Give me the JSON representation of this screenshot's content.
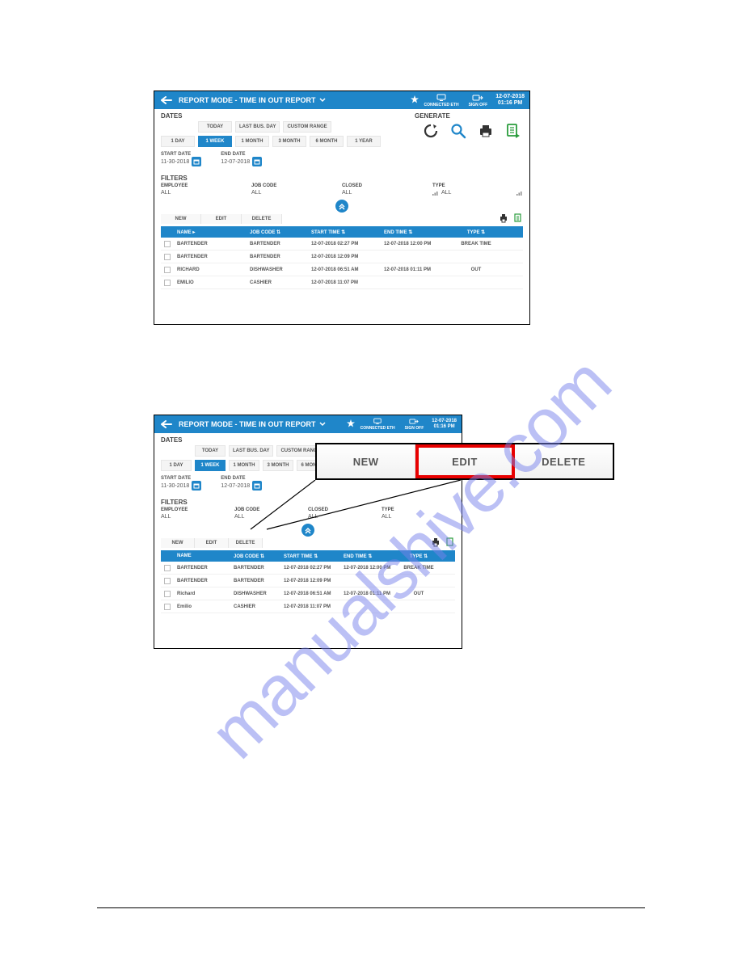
{
  "topbar": {
    "title": "REPORT MODE - TIME IN OUT REPORT",
    "connected": "CONNECTED ETH",
    "signoff": "SIGN OFF",
    "date": "12-07-2018",
    "time": "01:16 PM"
  },
  "dates": {
    "section": "DATES",
    "tabs_top": [
      "TODAY",
      "LAST BUS. DAY",
      "CUSTOM RANGE"
    ],
    "tabs_bot": [
      "1 DAY",
      "1 WEEK",
      "1 MONTH",
      "3 MONTH",
      "6 MONTH",
      "1 YEAR"
    ],
    "start_label": "START DATE",
    "start_value": "11-30-2018",
    "end_label": "END DATE",
    "end_value": "12-07-2018"
  },
  "generate": {
    "label": "GENERATE"
  },
  "filters": {
    "section": "FILTERS",
    "employee_label": "EMPLOYEE",
    "employee_value": "ALL",
    "jobcode_label": "JOB CODE",
    "jobcode_value": "ALL",
    "closed_label": "CLOSED",
    "closed_value": "ALL",
    "type_label": "TYPE",
    "type_value": "ALL"
  },
  "toolbar": {
    "new": "NEW",
    "edit": "EDIT",
    "delete": "DELETE"
  },
  "table": {
    "headers": {
      "name": "NAME ▸",
      "job": "JOB CODE ⇅",
      "start": "START TIME ⇅",
      "end": "END TIME ⇅",
      "type": "TYPE ⇅"
    },
    "rows": [
      {
        "name": "BARTENDER",
        "job": "BARTENDER",
        "start": "12-07-2018 02:27 PM",
        "end": "12-07-2018 12:00 PM",
        "type": "BREAK TIME"
      },
      {
        "name": "BARTENDER",
        "job": "BARTENDER",
        "start": "12-07-2018 12:09 PM",
        "end": "",
        "type": ""
      },
      {
        "name": "RICHARD",
        "job": "DISHWASHER",
        "start": "12-07-2018 06:51 AM",
        "end": "12-07-2018 01:11 PM",
        "type": "OUT"
      },
      {
        "name": "EMILIO",
        "job": "CASHIER",
        "start": "12-07-2018 11:07 PM",
        "end": "",
        "type": ""
      }
    ]
  },
  "topbar2": {
    "title": "REPORT MODE - TIME IN OUT REPORT",
    "connected": "CONNECTED ETH",
    "signoff": "SIGN OFF",
    "date": "12-07-2018",
    "time": "01:16 PM"
  },
  "dates2": {
    "section": "DATES",
    "tabs_top": [
      "TODAY",
      "LAST BUS. DAY",
      "CUSTOM RANGE"
    ],
    "tabs_bot": [
      "1 DAY",
      "1 WEEK",
      "1 MONTH",
      "3 MONTH",
      "6 MONTH"
    ],
    "start_label": "START DATE",
    "start_value": "11-30-2018",
    "end_label": "END DATE",
    "end_value": "12-07-2018"
  },
  "filters2": {
    "section": "FILTERS",
    "employee_label": "EMPLOYEE",
    "employee_value": "ALL",
    "jobcode_label": "JOB CODE",
    "jobcode_value": "ALL",
    "closed_label": "CLOSED",
    "closed_value": "ALL",
    "type_label": "TYPE",
    "type_value": "ALL"
  },
  "toolbar2": {
    "new": "NEW",
    "edit": "EDIT",
    "delete": "DELETE"
  },
  "table2": {
    "headers": {
      "name": "NAME",
      "job": "JOB CODE ⇅",
      "start": "START TIME ⇅",
      "end": "END TIME ⇅",
      "type": "TYPE ⇅"
    },
    "rows": [
      {
        "name": "BARTENDER",
        "job": "BARTENDER",
        "start": "12-07-2018 02:27 PM",
        "end": "12-07-2018 12:00 PM",
        "type": "BREAK TIME"
      },
      {
        "name": "BARTENDER",
        "job": "BARTENDER",
        "start": "12-07-2018 12:09 PM",
        "end": "",
        "type": ""
      },
      {
        "name": "Richard",
        "job": "DISHWASHER",
        "start": "12-07-2018 06:51 AM",
        "end": "12-07-2018 01:11 PM",
        "type": "OUT"
      },
      {
        "name": "Emilio",
        "job": "CASHIER",
        "start": "12-07-2018 11:07 PM",
        "end": "",
        "type": ""
      }
    ]
  },
  "callout": {
    "new": "NEW",
    "edit": "EDIT",
    "delete": "DELETE"
  }
}
